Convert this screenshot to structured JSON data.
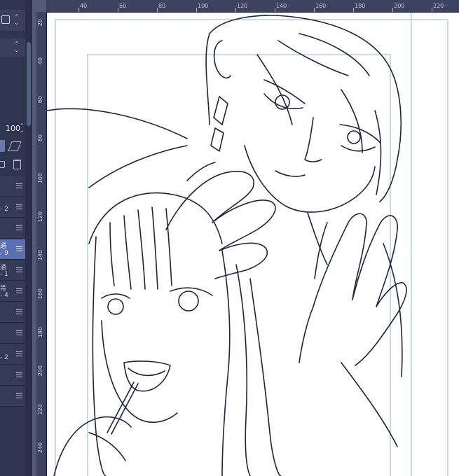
{
  "left_panel": {
    "opacity_value": "100",
    "layer_labels": [
      "2",
      "9",
      "1",
      "4",
      "2"
    ],
    "layer_label_prefixes": [
      "-",
      "通",
      "通",
      "帯",
      "-"
    ]
  },
  "rulers": {
    "top_ticks": [
      "40",
      "60",
      "80",
      "100",
      "120",
      "140",
      "160",
      "180",
      "200",
      "220"
    ],
    "left_ticks": [
      "20",
      "40",
      "60",
      "80",
      "100",
      "120",
      "140",
      "160",
      "180",
      "200",
      "220",
      "240"
    ]
  },
  "colors": {
    "accent": "#5b6fb5",
    "panel": "#30354f",
    "workspace": "#555a78",
    "ink": "#1f2340",
    "guide": "#8fb8c8"
  }
}
